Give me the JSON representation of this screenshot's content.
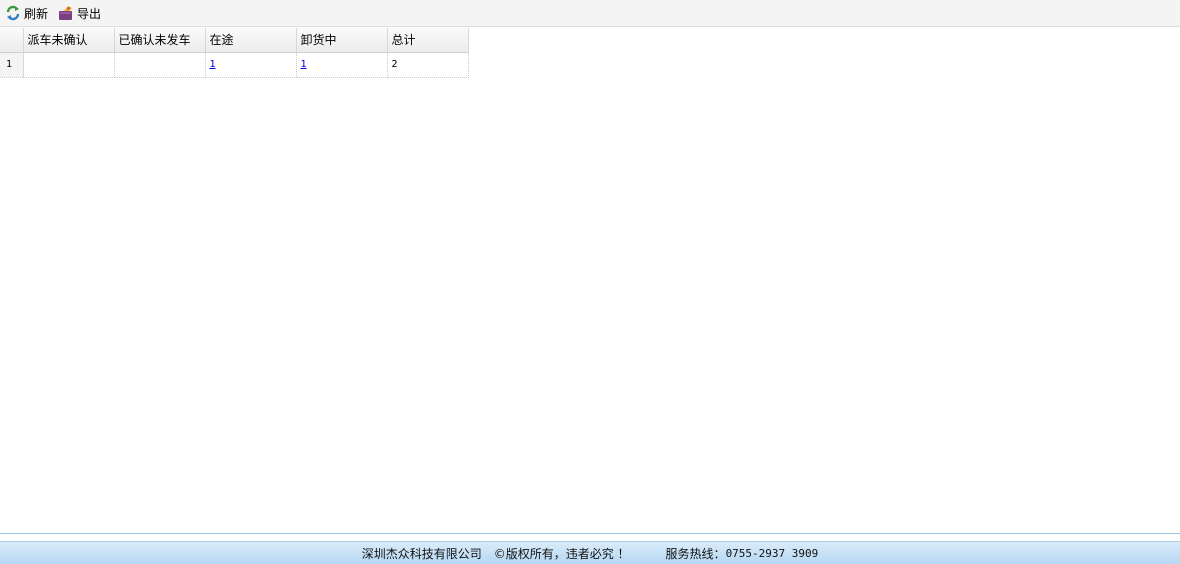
{
  "toolbar": {
    "refresh_label": "刷新",
    "export_label": "导出"
  },
  "grid": {
    "columns": [
      "派车未确认",
      "已确认未发车",
      "在途",
      "卸货中",
      "总计"
    ],
    "rows": [
      {
        "rownum": "1",
        "cells": [
          "",
          "",
          "1",
          "1",
          "2"
        ]
      }
    ]
  },
  "footer": {
    "company": "深圳杰众科技有限公司",
    "copyright": "©版权所有，违者必究 ！",
    "hotline_label": "服务热线：",
    "hotline": "0755-2937 3909"
  },
  "colors": {
    "link": "#0000cc",
    "footer_bg": "#c6e1f6",
    "toolbar_bg": "#f4f4f4"
  }
}
